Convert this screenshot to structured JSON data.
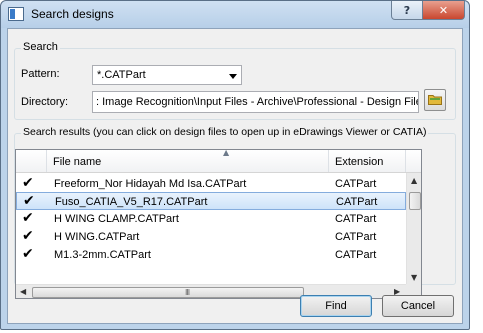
{
  "window": {
    "title": "Search designs"
  },
  "titlebar": {
    "help_glyph": "?",
    "close_glyph": "✕"
  },
  "search": {
    "group_label": "Search",
    "pattern_label": "Pattern:",
    "pattern_value": "*.CATPart",
    "directory_label": "Directory:",
    "directory_value": ": Image Recognition\\Input Files - Archive\\Professional - Design Files"
  },
  "results": {
    "group_label": "Search results (you can click on design files to open up in eDrawings Viewer or CATIA)",
    "columns": [
      "File name",
      "Extension"
    ],
    "rows": [
      {
        "check": "✔",
        "name": "Freeform_Nor Hidayah Md Isa.CATPart",
        "ext": "CATPart",
        "selected": false
      },
      {
        "check": "✔",
        "name": "Fuso_CATIA_V5_R17.CATPart",
        "ext": "CATPart",
        "selected": true
      },
      {
        "check": "✔",
        "name": "H WING CLAMP.CATPart",
        "ext": "CATPart",
        "selected": false
      },
      {
        "check": "✔",
        "name": "H WING.CATPart",
        "ext": "CATPart",
        "selected": false
      },
      {
        "check": "✔",
        "name": "M1.3-2mm.CATPart",
        "ext": "CATPart",
        "selected": false
      }
    ],
    "grip_glyph": "III"
  },
  "buttons": {
    "find": "Find",
    "cancel": "Cancel"
  },
  "colors": {
    "folder": "#e2b93b",
    "selection": "#cde3f9",
    "close": "#c9472f"
  }
}
